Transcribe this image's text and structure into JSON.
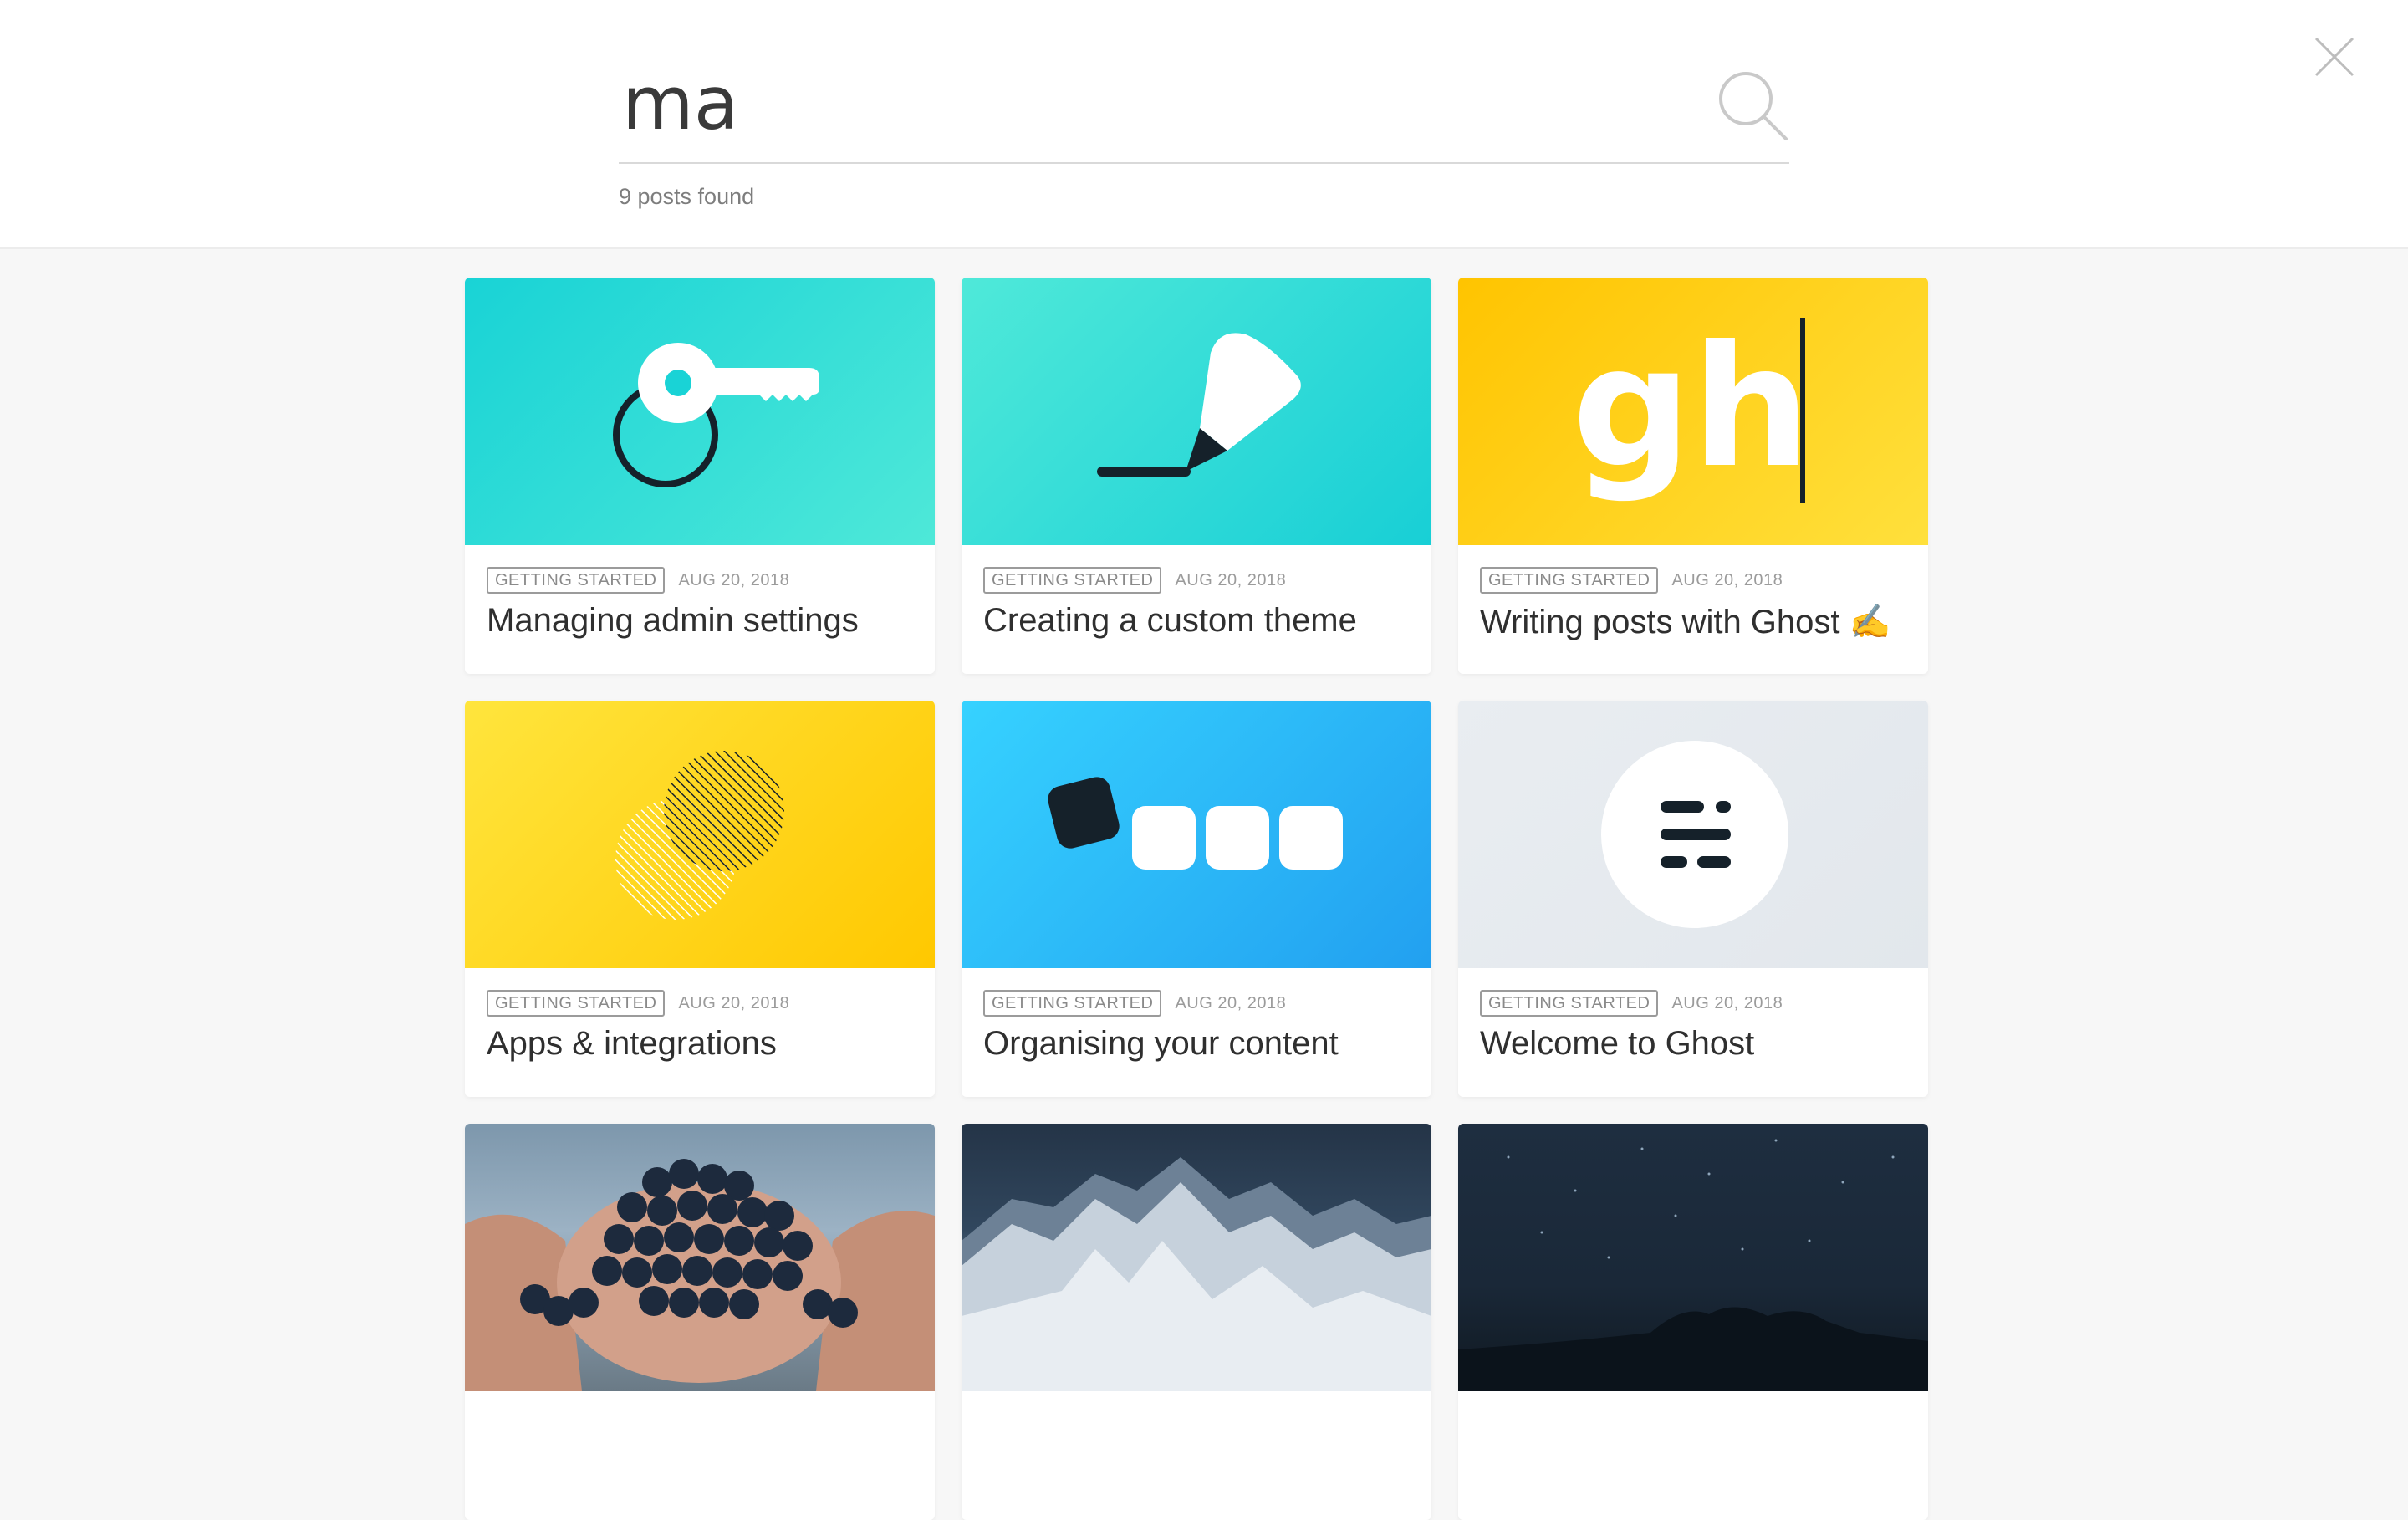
{
  "search": {
    "query": "ma",
    "results_count_text": "9 posts found"
  },
  "posts": [
    {
      "tag": "GETTING STARTED",
      "date": "AUG 20, 2018",
      "title": "Managing admin settings",
      "image": "key-icon"
    },
    {
      "tag": "GETTING STARTED",
      "date": "AUG 20, 2018",
      "title": "Creating a custom theme",
      "image": "marker-icon"
    },
    {
      "tag": "GETTING STARTED",
      "date": "AUG 20, 2018",
      "title": "Writing posts with Ghost ✍️",
      "image": "gh-cursor-graphic",
      "image_text": "gh"
    },
    {
      "tag": "GETTING STARTED",
      "date": "AUG 20, 2018",
      "title": "Apps & integrations",
      "image": "overlapping-circles-graphic"
    },
    {
      "tag": "GETTING STARTED",
      "date": "AUG 20, 2018",
      "title": "Organising your content",
      "image": "tag-blocks-graphic"
    },
    {
      "tag": "GETTING STARTED",
      "date": "AUG 20, 2018",
      "title": "Welcome to Ghost",
      "image": "ghost-logo-icon"
    },
    {
      "image": "grapes-photo"
    },
    {
      "image": "mountain-photo"
    },
    {
      "image": "night-sky-photo"
    }
  ],
  "colors": {
    "teal": "#19d3d6",
    "yellow": "#ffc400",
    "blue": "#22a0f0",
    "dark": "#15212a"
  }
}
